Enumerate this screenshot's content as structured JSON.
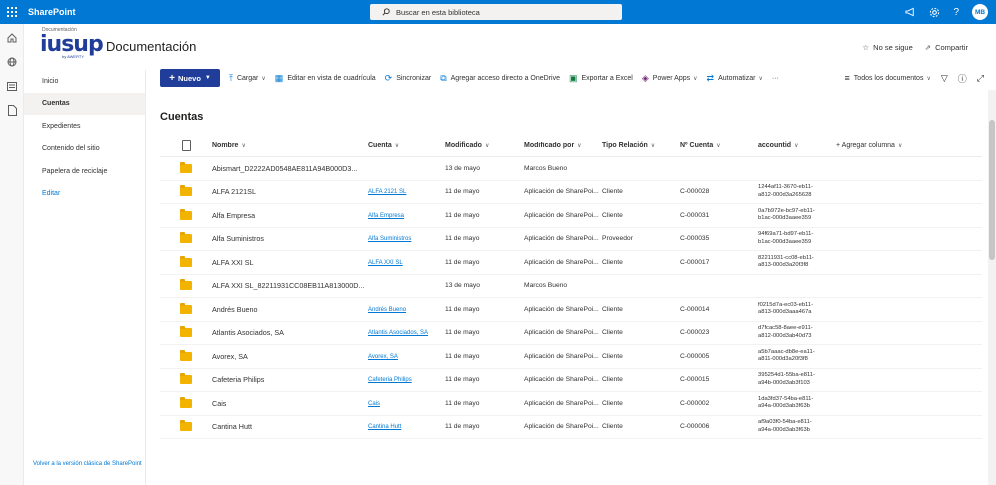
{
  "suite": {
    "app_name": "SharePoint",
    "search_placeholder": "Buscar en esta biblioteca",
    "avatar_initials": "MB"
  },
  "site": {
    "logo_caption": "Documentación",
    "logo_text": "iusup",
    "logo_by": "by AWERTY",
    "title": "Documentación",
    "follow_label": "No se sigue",
    "share_label": "Compartir"
  },
  "nav": {
    "items": [
      {
        "label": "Inicio"
      },
      {
        "label": "Cuentas"
      },
      {
        "label": "Expedientes"
      },
      {
        "label": "Contenido del sitio"
      },
      {
        "label": "Papelera de reciclaje"
      },
      {
        "label": "Editar"
      }
    ],
    "footer": "Volver a la versión clásica de SharePoint"
  },
  "commands": {
    "new_label": "Nuevo",
    "upload": "Cargar",
    "grid": "Editar en vista de cuadrícula",
    "sync": "Sincronizar",
    "onedrive": "Agregar acceso directo a OneDrive",
    "excel": "Exportar a Excel",
    "powerapps": "Power Apps",
    "automate": "Automatizar",
    "more": "···",
    "view": "Todos los documentos"
  },
  "list": {
    "title": "Cuentas",
    "headers": {
      "nombre": "Nombre",
      "cuenta": "Cuenta",
      "modificado": "Modificado",
      "modificado_por": "Modificado por",
      "tipo": "Tipo Relación",
      "ncuenta": "Nº Cuenta",
      "accountid": "accountid",
      "add": "+ Agregar columna"
    },
    "rows": [
      {
        "name": "Abismart_D2222AD0548AE811A94B000D3...",
        "cuenta": "",
        "mod": "13 de mayo",
        "modby": "Marcos Bueno",
        "tipo": "",
        "ncta": "",
        "acc1": "",
        "acc2": ""
      },
      {
        "name": "ALFA 2121SL",
        "cuenta": "ALFA 2121 SL",
        "mod": "11 de mayo",
        "modby": "Aplicación de SharePoi...",
        "tipo": "Cliente",
        "ncta": "C-000028",
        "acc1": "1244af11-3670-eb11-",
        "acc2": "a812-000d3a265628"
      },
      {
        "name": "Alfa Empresa",
        "cuenta": "Alfa Empresa",
        "mod": "11 de mayo",
        "modby": "Aplicación de SharePoi...",
        "tipo": "Cliente",
        "ncta": "C-000031",
        "acc1": "0a7b972e-bc97-eb11-",
        "acc2": "b1ac-000d3aaee359"
      },
      {
        "name": "Alfa Suministros",
        "cuenta": "Alfa Suministros",
        "mod": "11 de mayo",
        "modby": "Aplicación de SharePoi...",
        "tipo": "Proveedor",
        "ncta": "C-000035",
        "acc1": "94f69a71-bd97-eb11-",
        "acc2": "b1ac-000d3aaee359"
      },
      {
        "name": "ALFA XXI SL",
        "cuenta": "ALFA XXI SL",
        "mod": "11 de mayo",
        "modby": "Aplicación de SharePoi...",
        "tipo": "Cliente",
        "ncta": "C-000017",
        "acc1": "82211931-cc08-eb11-",
        "acc2": "a813-000d3a20f3f8"
      },
      {
        "name": "ALFA XXI SL_82211931CC08EB11A813000D...",
        "cuenta": "",
        "mod": "13 de mayo",
        "modby": "Marcos Bueno",
        "tipo": "",
        "ncta": "",
        "acc1": "",
        "acc2": ""
      },
      {
        "name": "Andrés Bueno",
        "cuenta": "Andrés Bueno",
        "mod": "11 de mayo",
        "modby": "Aplicación de SharePoi...",
        "tipo": "Cliente",
        "ncta": "C-000014",
        "acc1": "f0215d7a-ec03-eb11-",
        "acc2": "a813-000d3aaa467a"
      },
      {
        "name": "Atlantis Asociados, SA",
        "cuenta": "Atlantis Asociados, SA",
        "mod": "11 de mayo",
        "modby": "Aplicación de SharePoi...",
        "tipo": "Cliente",
        "ncta": "C-000023",
        "acc1": "d7fcac58-8aee-e911-",
        "acc2": "a812-000d3ab40d73"
      },
      {
        "name": "Avorex, SA",
        "cuenta": "Avorex, SA",
        "mod": "11 de mayo",
        "modby": "Aplicación de SharePoi...",
        "tipo": "Cliente",
        "ncta": "C-000005",
        "acc1": "a5b7aaac-db8e-ea11-",
        "acc2": "a811-000d3a20f3f8"
      },
      {
        "name": "Cafeteria Philips",
        "cuenta": "Cafeteria Philips",
        "mod": "11 de mayo",
        "modby": "Aplicación de SharePoi...",
        "tipo": "Cliente",
        "ncta": "C-000015",
        "acc1": "395254d1-55ba-e811-",
        "acc2": "a94b-000d3ab3f103"
      },
      {
        "name": "Cais",
        "cuenta": "Cais",
        "mod": "11 de mayo",
        "modby": "Aplicación de SharePoi...",
        "tipo": "Cliente",
        "ncta": "C-000002",
        "acc1": "1da3fd37-54ba-e811-",
        "acc2": "a94a-000d3ab3f63b"
      },
      {
        "name": "Cantina Hutt",
        "cuenta": "Cantina Hutt",
        "mod": "11 de mayo",
        "modby": "Aplicación de SharePoi...",
        "tipo": "Cliente",
        "ncta": "C-000006",
        "acc1": "af9a03f0-54ba-e811-",
        "acc2": "a94a-000d3ab3f63b"
      }
    ]
  },
  "colors": {
    "suite_blue": "#0078d4",
    "new_button": "#1f3d99",
    "folder": "#f2b400"
  }
}
